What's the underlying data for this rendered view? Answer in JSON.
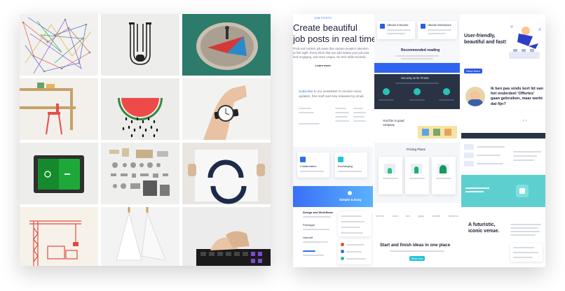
{
  "hero": {
    "tag": "JOB POSTS",
    "title_line1": "Create beautiful",
    "title_line2": "job posts in real time.",
    "body": "Fluid and modern job posts that capture people's attention at first sight. Every block that you add makes your job post look engaging, and more unique. No tech skills involved.",
    "link": "Learn more"
  },
  "widgets": {
    "card1_title": "Ultimate Enterprise",
    "card2_title": "Ultimate Marketplace",
    "recommended": "Recommended reading",
    "ufb_line1": "User-friendly,",
    "ufb_line2": "beautiful and fast!",
    "read_btn": "Read More",
    "security": "Security at its Finest",
    "subscribe_prefix": "Subscribe",
    "subscribe_rest": "to our newsletter to receive news, updates, free stuff and new releases by email.",
    "ikben": "Ik ben pas sinds kort lid van het onderdeel 'Offertes' gaan gebruiken, maar werkt dat fijn?",
    "fine_company": "You'll be in good company",
    "pricing": "Pricing Plans",
    "collaboration": "Collaboration",
    "exchanging": "Exchanging",
    "simple_easy": "Simple & Easy",
    "design_workflow": "Design and Workflows",
    "prototype": "Prototype",
    "handoff": "Handoff",
    "start_finish": "Start and finish ideas in one place",
    "start_btn": "Start now",
    "futuristic_line1": "A futuristic,",
    "futuristic_line2": "iconic venue.",
    "logos": [
      "mmme",
      "zorix",
      "stix",
      "gaqo",
      "tsmbbi",
      "behamo"
    ]
  },
  "colors": {
    "brand_blue": "#1f4fff",
    "dark_navy": "#2a3344",
    "teal": "#5ecfcf",
    "gradient_start": "#3a6ff8",
    "gradient_end": "#5ab2fb",
    "accent_cyan": "#22c3d6"
  }
}
